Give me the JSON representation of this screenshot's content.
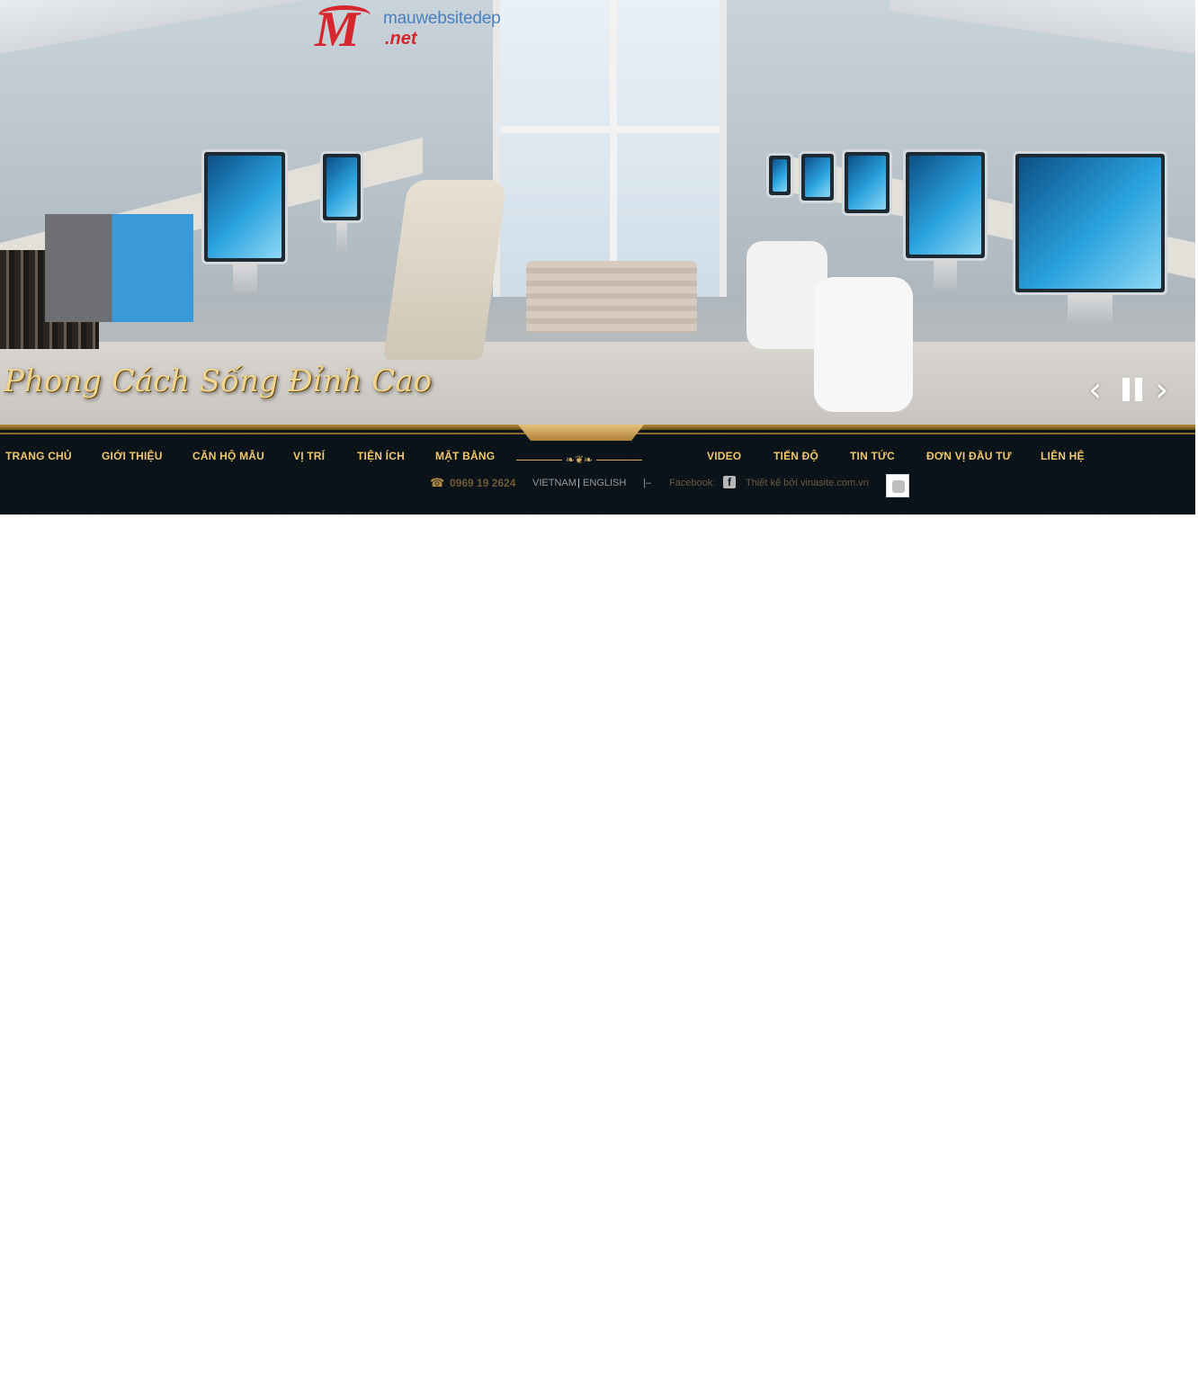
{
  "logo": {
    "name": "mauwebsitedep",
    "tld": ".net"
  },
  "hero": {
    "slogan": "Phong Cách Sống Đỉnh Cao",
    "controls": {
      "prev": "‹",
      "next": "›"
    }
  },
  "nav": {
    "items": [
      "TRANG CHỦ",
      "GIỚI THIỆU",
      "CĂN HỘ MẪU",
      "VỊ TRÍ",
      "TIỆN ÍCH",
      "MẶT BẰNG",
      "VIDEO",
      "TIẾN ĐỘ",
      "TIN TỨC",
      "ĐƠN VỊ ĐẦU TƯ",
      "LIÊN HỆ"
    ]
  },
  "footer": {
    "phone": "0969 19 2624",
    "lang_vn": "VIETNAM",
    "lang_sep": "|",
    "lang_en": "ENGLISH",
    "pipe": "|–",
    "facebook_label": "Facebook:",
    "credit": "Thiết kế bởi vinasite.com.vn"
  },
  "colors": {
    "nav_gold": "#f0c66e",
    "nav_bg": "#0b141b",
    "logo_red": "#d6262e",
    "logo_blue": "#4a7fc1"
  },
  "icons": [
    "phone-icon",
    "facebook-icon",
    "plugin-icon",
    "prev-arrow-icon",
    "pause-icon",
    "next-arrow-icon"
  ]
}
